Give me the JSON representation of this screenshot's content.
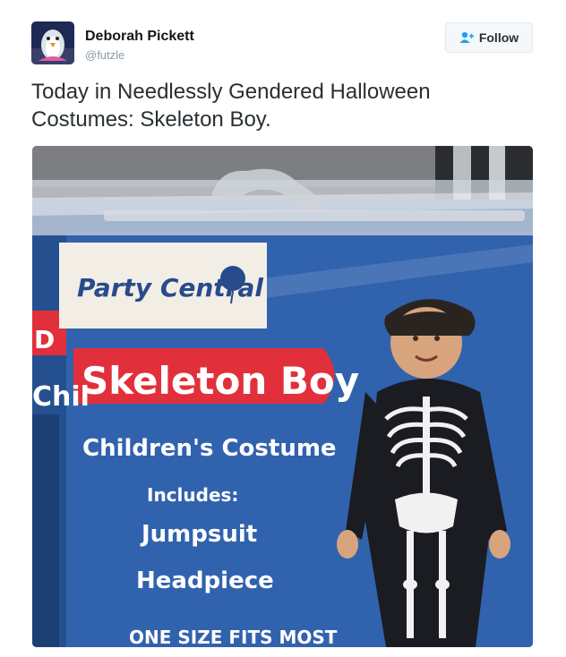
{
  "author": {
    "name": "Deborah Pickett",
    "handle": "@futzle"
  },
  "follow_button": {
    "label": "Follow",
    "icon": "add-user-icon"
  },
  "tweet": {
    "text": "Today in Needlessly Gendered Halloween Costumes: Skeleton Boy."
  },
  "photo": {
    "brand": "Party Central",
    "product_name": "Skeleton Boy",
    "subtitle": "Children's Costume",
    "includes_label": "Includes:",
    "items": [
      "Jumpsuit",
      "Headpiece"
    ],
    "size_note": "ONE SIZE FITS MOST",
    "edge_text_1": "Chil",
    "edge_text_2": "D"
  },
  "colors": {
    "text": "#292f33",
    "muted": "#8899a6",
    "link_blue": "#1da1f2",
    "package_blue": "#2b5aa6",
    "label_red": "#e1303b"
  }
}
